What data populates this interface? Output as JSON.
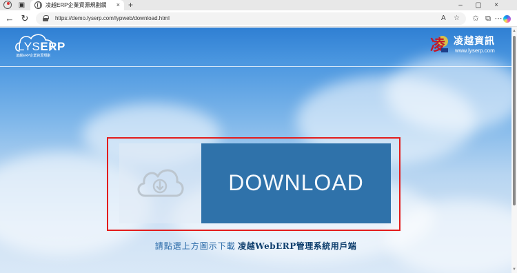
{
  "browser": {
    "tab_title": "凌越ERP企業資源規劃網",
    "tab_close": "×",
    "new_tab": "+",
    "url": "https://demo.lyserp.com/lypweb/download.html",
    "window_controls": {
      "minimize": "–",
      "maximize": "▢",
      "close": "×"
    },
    "icons": [
      "profile-icon",
      "tab-actions-icon",
      "globe-icon",
      "back-icon",
      "refresh-icon",
      "lock-icon",
      "read-aloud-icon",
      "favorite-icon",
      "favorites-icon",
      "extensions-icon",
      "more-icon",
      "copilot-icon"
    ]
  },
  "page": {
    "logo": {
      "brand_main": "LYS",
      "brand_bold": "ERP",
      "subtitle": "凌越ERP企業資源規劃"
    },
    "company": {
      "name": "凌越資訊",
      "site": "www.lyserp.com",
      "mark_char": "凌"
    },
    "download": {
      "label": "DOWNLOAD",
      "icon": "cloud-download-icon"
    },
    "caption": {
      "prefix": "請點選上方圖示下載",
      "product": "凌越WebERP管理系統用戶端"
    },
    "colors": {
      "download_bg": "#2f72aa",
      "highlight": "#e31c1c",
      "sky_top": "#2f7fd3"
    }
  }
}
